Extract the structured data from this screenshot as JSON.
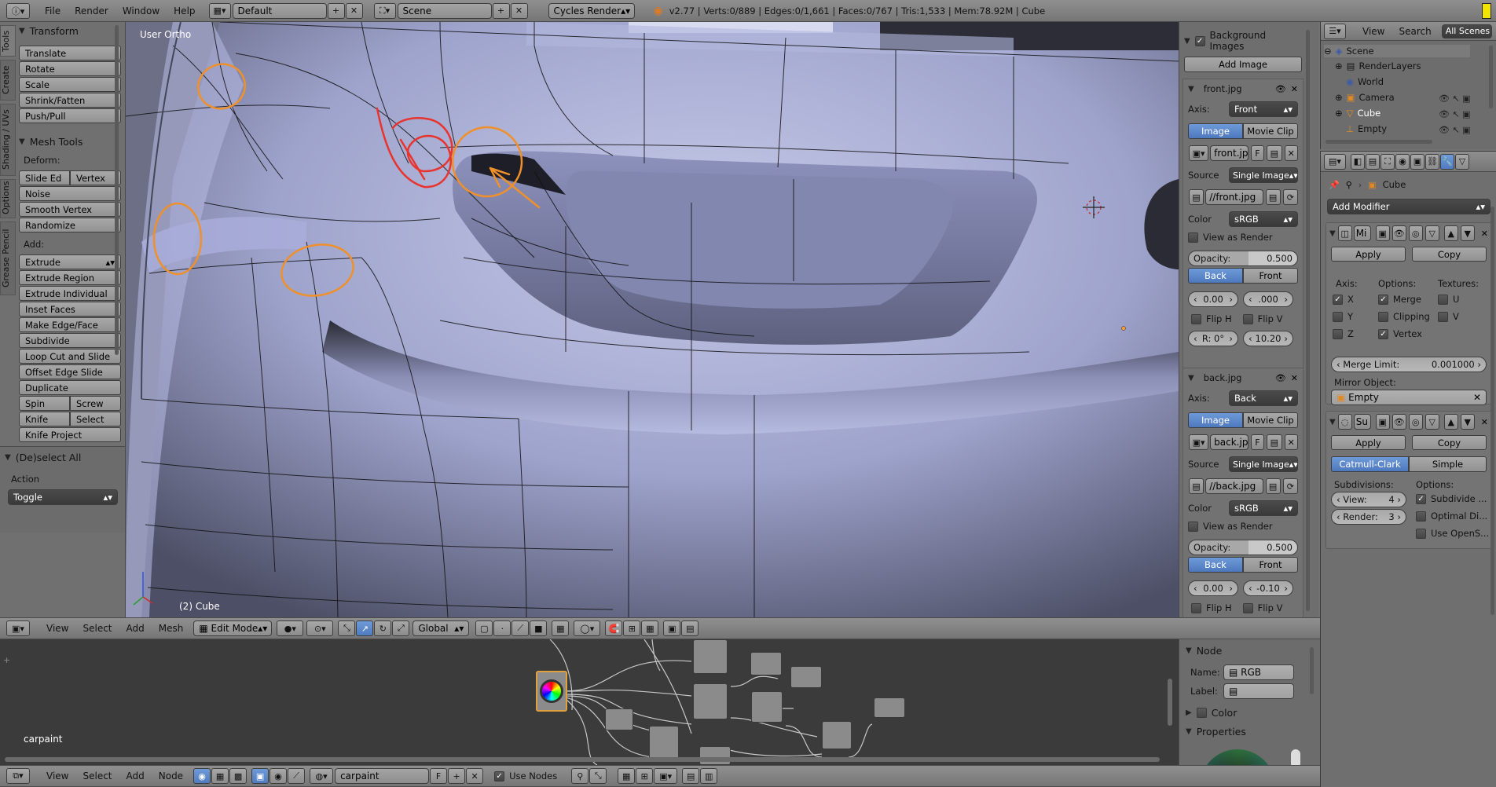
{
  "topbar": {
    "menus": [
      "File",
      "Render",
      "Window",
      "Help"
    ],
    "layout": "Default",
    "scene": "Scene",
    "engine": "Cycles Render",
    "stats": "v2.77 | Verts:0/889 | Edges:0/1,661 | Faces:0/767 | Tris:1,533 | Mem:78.92M | Cube"
  },
  "toolshelf": {
    "tabs": [
      "Tools",
      "Create",
      "Shading / UVs",
      "Options",
      "Grease Pencil"
    ],
    "transform_title": "Transform",
    "transform_buttons": [
      "Translate",
      "Rotate",
      "Scale",
      "Shrink/Fatten",
      "Push/Pull"
    ],
    "mesh_tools_title": "Mesh Tools",
    "deform_label": "Deform:",
    "slide_edge": "Slide Ed",
    "vertex": "Vertex",
    "noise": "Noise",
    "smooth_vertex": "Smooth Vertex",
    "randomize": "Randomize",
    "add_label": "Add:",
    "extrude": "Extrude",
    "add_buttons": [
      "Extrude Region",
      "Extrude Individual",
      "Inset Faces",
      "Make Edge/Face",
      "Subdivide",
      "Loop Cut and Slide",
      "Offset Edge Slide",
      "Duplicate"
    ],
    "spin": "Spin",
    "screw": "Screw",
    "knife": "Knife",
    "select": "Select",
    "knife_project": "Knife Project",
    "op_title": "(De)select All",
    "action_label": "Action",
    "action_value": "Toggle"
  },
  "viewport": {
    "view_name": "User Ortho",
    "object_label": "(2) Cube"
  },
  "view3d_header": {
    "menus": [
      "View",
      "Select",
      "Add",
      "Mesh"
    ],
    "mode": "Edit Mode",
    "orientation": "Global"
  },
  "npanel": {
    "bg_images_title": "Background Images",
    "add_image": "Add Image",
    "images": [
      {
        "name": "front.jpg",
        "axis_label": "Axis:",
        "axis": "Front",
        "tab_image": "Image",
        "tab_movie": "Movie Clip",
        "file": "front.jpg",
        "flag": "F",
        "source_label": "Source",
        "source": "Single Image",
        "path": "//front.jpg",
        "color_label": "Color",
        "color": "sRGB",
        "view_as_render": "View as Render",
        "opacity_label": "Opacity:",
        "opacity": "0.500",
        "back": "Back",
        "front": "Front",
        "x": "0.00",
        "y": ".000",
        "flip_h": "Flip H",
        "flip_v": "Flip V",
        "rot": "R: 0°",
        "size": "10.20"
      },
      {
        "name": "back.jpg",
        "axis_label": "Axis:",
        "axis": "Back",
        "tab_image": "Image",
        "tab_movie": "Movie Clip",
        "file": "back.jpg",
        "flag": "F",
        "source_label": "Source",
        "source": "Single Image",
        "path": "//back.jpg",
        "color_label": "Color",
        "color": "sRGB",
        "view_as_render": "View as Render",
        "opacity_label": "Opacity:",
        "opacity": "0.500",
        "back": "Back",
        "front": "Front",
        "x": "0.00",
        "y": "-0.10",
        "flip_h": "Flip H",
        "flip_v": "Flip V"
      }
    ]
  },
  "outliner": {
    "menus": [
      "View",
      "Search"
    ],
    "filter": "All Scenes",
    "items": [
      "Scene",
      "RenderLayers",
      "World",
      "Camera",
      "Cube",
      "Empty"
    ]
  },
  "properties": {
    "context_object": "Cube",
    "add_modifier": "Add Modifier",
    "mirror": {
      "name": "Mi",
      "apply": "Apply",
      "copy": "Copy",
      "axis_label": "Axis:",
      "options_label": "Options:",
      "textures_label": "Textures:",
      "x": "X",
      "y": "Y",
      "z": "Z",
      "merge": "Merge",
      "clipping": "Clipping",
      "vertex": "Vertex",
      "u": "U",
      "v": "V",
      "merge_limit_label": "Merge Limit:",
      "merge_limit": "0.001000",
      "mirror_object_label": "Mirror Object:",
      "mirror_object": "Empty"
    },
    "subsurf": {
      "name": "Su",
      "apply": "Apply",
      "copy": "Copy",
      "catmull": "Catmull-Clark",
      "simple": "Simple",
      "subdivisions_label": "Subdivisions:",
      "options_label": "Options:",
      "view_label": "View:",
      "view": "4",
      "render_label": "Render:",
      "render": "3",
      "subdivide_uvs": "Subdivide ...",
      "optimal_display": "Optimal Di...",
      "use_opensubdiv": "Use OpenS..."
    }
  },
  "node_editor": {
    "material_label": "carpaint",
    "menus": [
      "View",
      "Select",
      "Add",
      "Node"
    ],
    "material": "carpaint",
    "flag": "F",
    "use_nodes": "Use Nodes",
    "side": {
      "node_title": "Node",
      "name_label": "Name:",
      "name": "RGB",
      "label_label": "Label:",
      "color_title": "Color",
      "properties_title": "Properties"
    }
  },
  "colors": {
    "selected_blue": "#5680c2",
    "annotation_orange": "#f0902a",
    "annotation_red": "#e8342f",
    "mesh_surface": "#a7acd6"
  }
}
